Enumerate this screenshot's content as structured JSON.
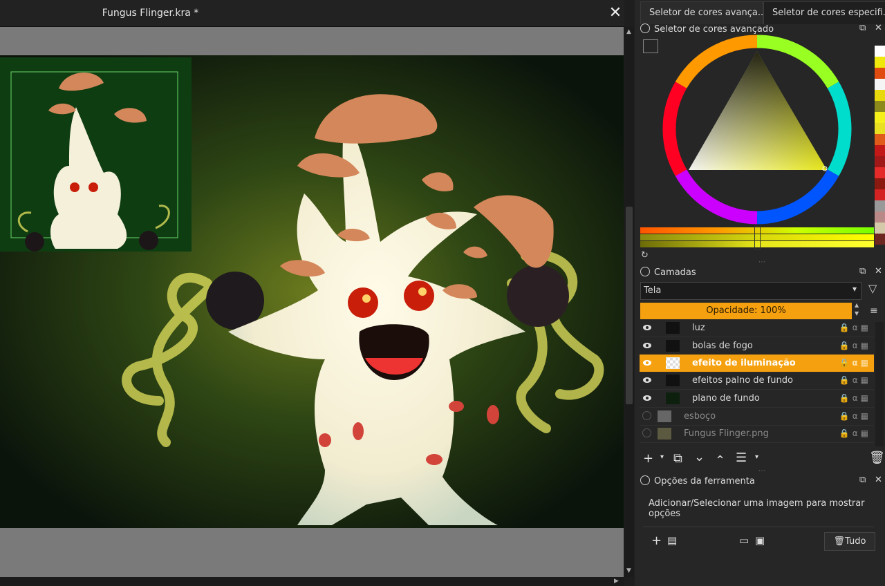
{
  "document": {
    "title": "Fungus Flinger.kra *",
    "close_glyph": "✕"
  },
  "docker_tabs": [
    "Seletor de cores avança...",
    "Seletor de cores especifi..."
  ],
  "color_selector": {
    "title": "Seletor de cores avançado",
    "accent": "#e6e61a"
  },
  "layers_panel": {
    "title": "Camadas",
    "blend_mode": "Tela",
    "opacity_text": "Opacidade:  100%",
    "layers": [
      {
        "name": "luz",
        "visible": true,
        "active": false
      },
      {
        "name": "bolas de fogo",
        "visible": true,
        "active": false
      },
      {
        "name": "efeito de iluminação",
        "visible": true,
        "active": true
      },
      {
        "name": "efeitos palno de fundo",
        "visible": true,
        "active": false
      },
      {
        "name": "plano de fundo",
        "visible": true,
        "active": false
      },
      {
        "name": "esboço",
        "visible": false,
        "active": false
      },
      {
        "name": "Fungus Flinger.png",
        "visible": false,
        "active": false
      }
    ]
  },
  "tool_options": {
    "title": "Opções da ferramenta",
    "message": "Adicionar/Selecionar uma imagem para mostrar opções",
    "all_button": "Tudo"
  },
  "colors": {
    "accent": "#f5a10f",
    "bg_dark": "#1e1e1e",
    "panel": "#262626"
  }
}
